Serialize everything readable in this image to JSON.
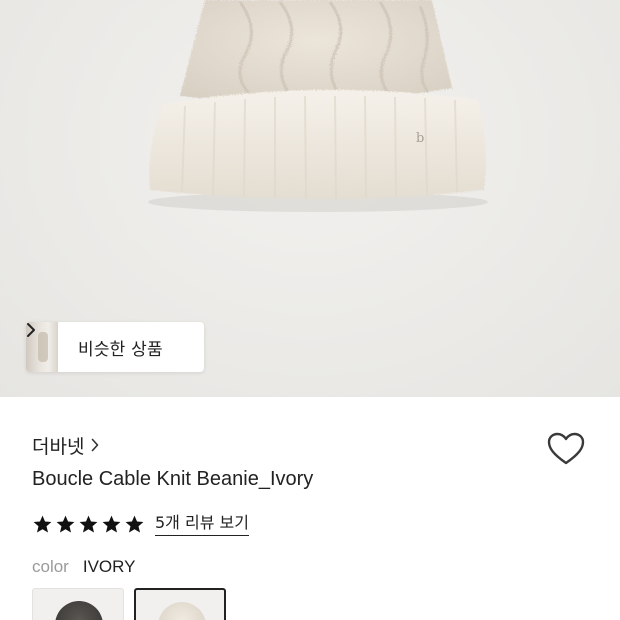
{
  "colors": {
    "beanie": "#efe9df",
    "beanie_shadow": "#d9d2c6",
    "heart_stroke": "#3a3a3a",
    "star": "#111111",
    "swatch_dark": "#4a4744",
    "swatch_ivory": "#e9e3d9"
  },
  "hero": {
    "similar_products_label": "비슷한 상품",
    "chevron_icon": "chevron-right-icon"
  },
  "product": {
    "brand": "더바넷",
    "brand_chevron_icon": "chevron-right-icon",
    "wishlist_icon": "heart-outline-icon",
    "title": "Boucle Cable Knit Beanie_Ivory",
    "rating": {
      "stars": 5,
      "max_stars": 5,
      "review_link": "5개 리뷰 보기"
    },
    "color_option": {
      "label": "color",
      "value": "IVORY"
    },
    "swatches": [
      {
        "name": "dark",
        "selected": false
      },
      {
        "name": "ivory",
        "selected": true
      }
    ]
  }
}
